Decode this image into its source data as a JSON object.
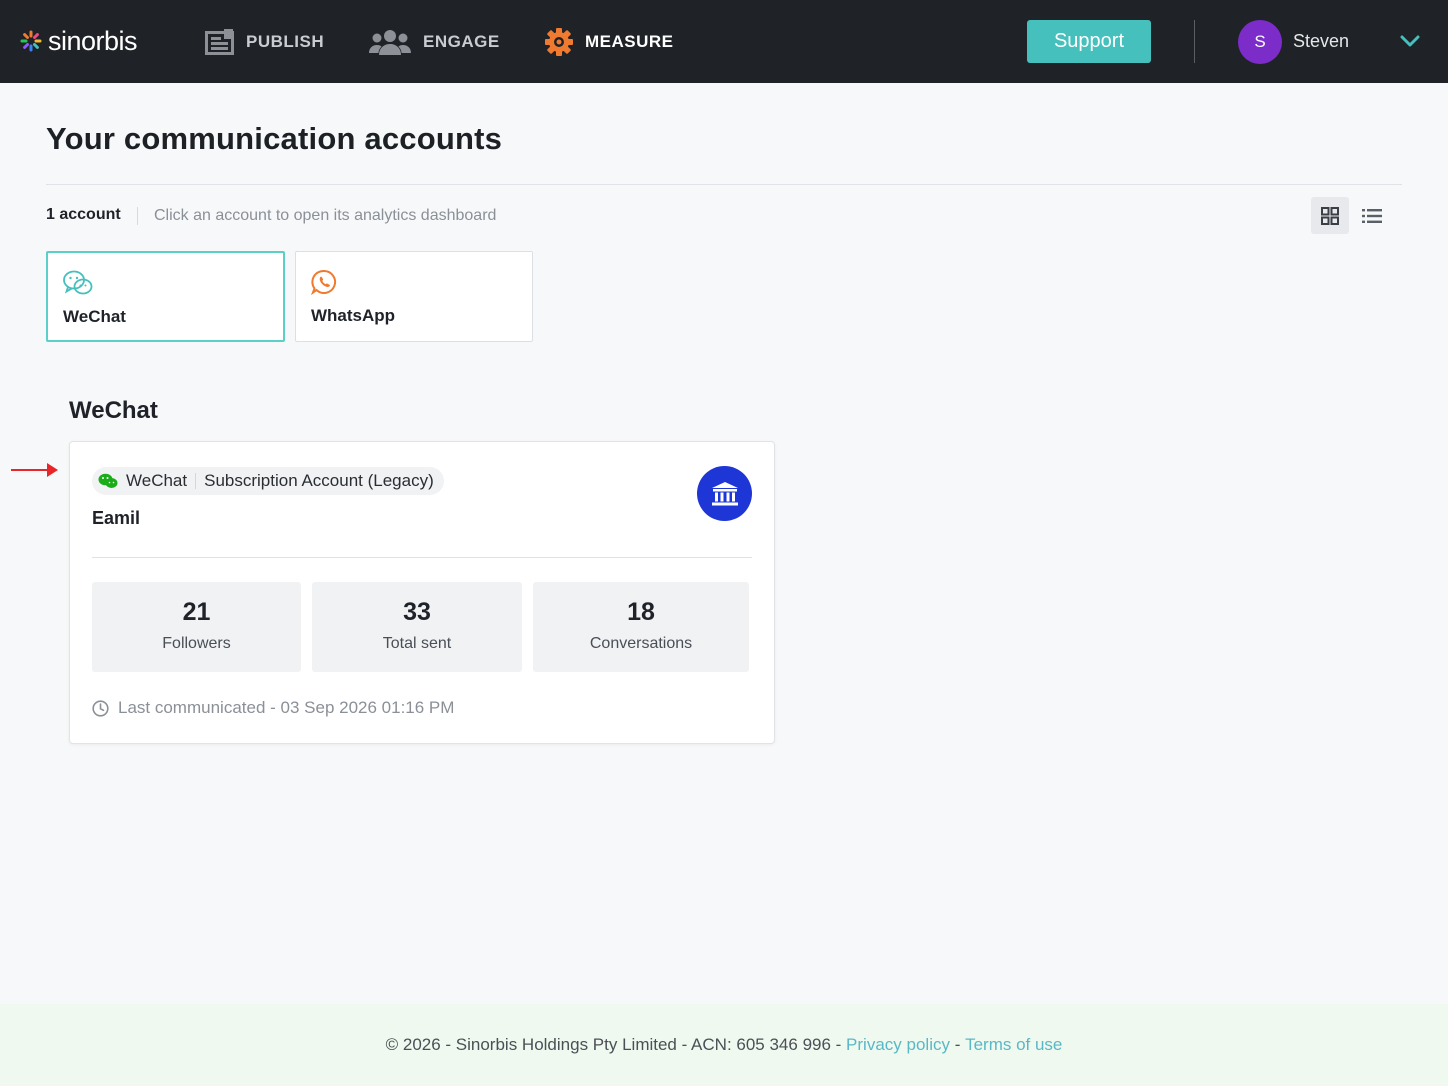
{
  "brand": {
    "name": "sinorbis"
  },
  "nav": {
    "items": [
      {
        "label": "PUBLISH",
        "icon": "publish-icon"
      },
      {
        "label": "ENGAGE",
        "icon": "users-icon"
      },
      {
        "label": "MEASURE",
        "icon": "measure-gear-icon",
        "active": true
      }
    ],
    "support_label": "Support",
    "user": {
      "initial": "S",
      "name": "Steven",
      "avatar_color": "#7b2cc9"
    }
  },
  "page": {
    "title": "Your communication accounts",
    "account_count": "1 account",
    "hint": "Click an account to open its analytics dashboard"
  },
  "channels": [
    {
      "label": "WeChat",
      "icon": "wechat-icon",
      "selected": true
    },
    {
      "label": "WhatsApp",
      "icon": "whatsapp-icon",
      "selected": false
    }
  ],
  "section": {
    "title": "WeChat"
  },
  "account": {
    "platform": "WeChat",
    "type": "Subscription Account (Legacy)",
    "name": "Eamil",
    "badge_icon": "institution-icon",
    "stats": [
      {
        "value": "21",
        "label": "Followers"
      },
      {
        "value": "33",
        "label": "Total sent"
      },
      {
        "value": "18",
        "label": "Conversations"
      }
    ],
    "last_communicated": "Last communicated - 03 Sep 2026 01:16 PM"
  },
  "footer": {
    "text": "© 2026 - Sinorbis Holdings Pty Limited - ACN: 605 346 996 - ",
    "privacy": "Privacy policy",
    "separator": " - ",
    "terms": "Terms of use"
  },
  "colors": {
    "accent": "#46c0bc",
    "topbar": "#1f2327",
    "selected_border": "#5ccfc8",
    "measure_orange": "#f07a2f",
    "badge_blue": "#1f36d6",
    "link": "#5ab8c6"
  }
}
